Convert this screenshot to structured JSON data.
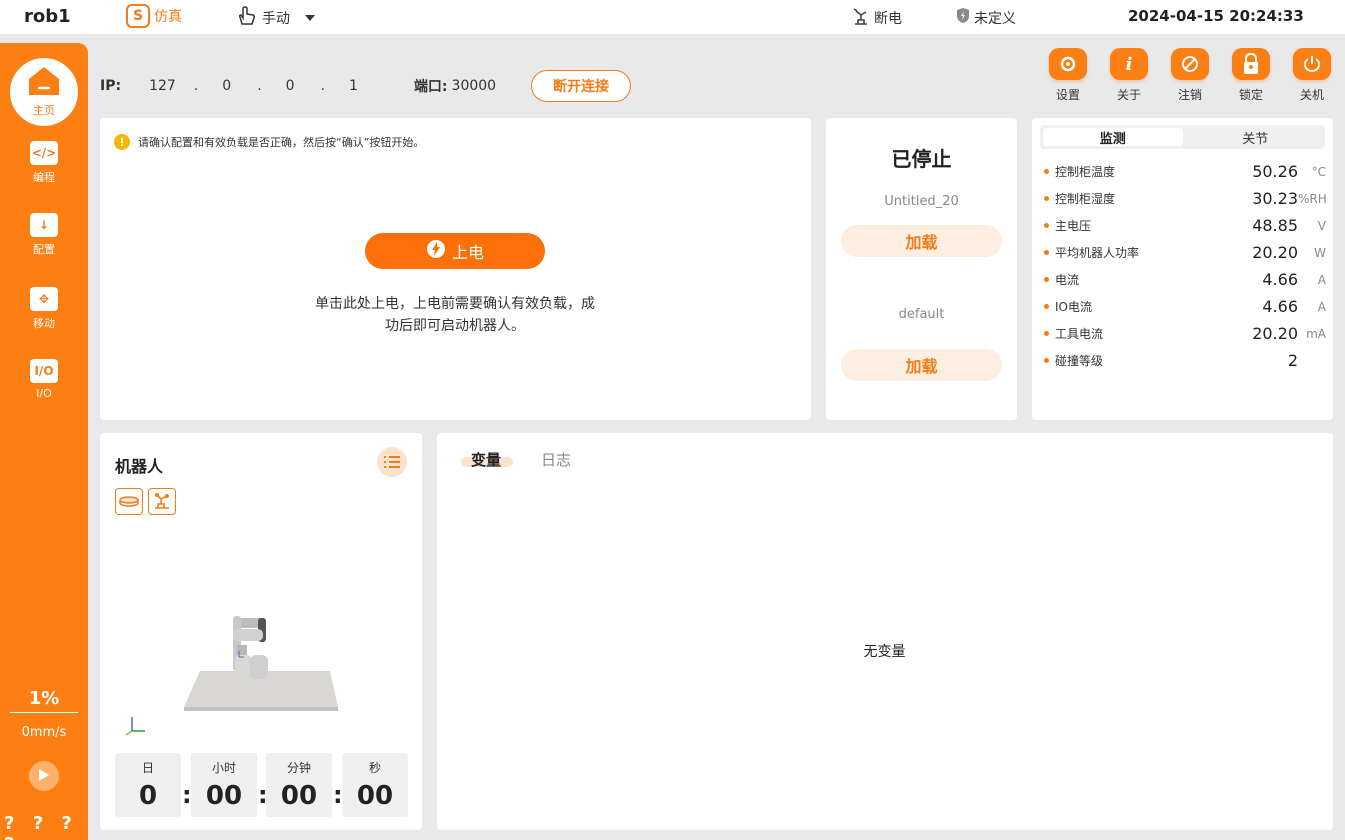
{
  "topbar": {
    "robot_name": "rob1",
    "sim_icon": "S",
    "sim_label": "仿真",
    "manual_label": "手动",
    "power_status": "断电",
    "safety_status": "未定义",
    "datetime": "2024-04-15 20:24:33"
  },
  "sidebar": {
    "home_label": "主页",
    "items": [
      {
        "label": "编程",
        "icon": "</>"
      },
      {
        "label": "配置",
        "icon": "↓"
      },
      {
        "label": "移动",
        "icon": "✥"
      },
      {
        "label": "I/O",
        "icon": "I/O"
      }
    ],
    "speed_percent": "1%",
    "speed_value": "0mm/s",
    "bottom_marks": "? ? ? ?"
  },
  "connection": {
    "ip_label": "IP:",
    "ip": [
      "127",
      "0",
      "0",
      "1"
    ],
    "port_label": "端口:",
    "port": "30000",
    "disconnect_label": "断开连接"
  },
  "actions": [
    {
      "label": "设置",
      "icon": "gear"
    },
    {
      "label": "关于",
      "icon": "info"
    },
    {
      "label": "注销",
      "icon": "logout"
    },
    {
      "label": "锁定",
      "icon": "lock"
    },
    {
      "label": "关机",
      "icon": "power"
    }
  ],
  "main_panel": {
    "notice": "请确认配置和有效负载是否正确，然后按“确认”按钮开始。",
    "power_on_label": "上电",
    "power_desc_1": "单击此处上电，上电前需要确认有效负载，成",
    "power_desc_2": "功后即可启动机器人。"
  },
  "program_panel": {
    "status": "已停止",
    "program_name": "Untitled_20",
    "load_label_1": "加载",
    "payload_name": "default",
    "load_label_2": "加载"
  },
  "monitor": {
    "tab_monitor": "监测",
    "tab_joint": "关节",
    "rows": [
      {
        "label": "控制柜温度",
        "value": "50.26",
        "unit": "°C"
      },
      {
        "label": "控制柜湿度",
        "value": "30.23",
        "unit": "%RH"
      },
      {
        "label": "主电压",
        "value": "48.85",
        "unit": "V"
      },
      {
        "label": "平均机器人功率",
        "value": "20.20",
        "unit": "W"
      },
      {
        "label": "电流",
        "value": "4.66",
        "unit": "A"
      },
      {
        "label": "IO电流",
        "value": "4.66",
        "unit": "A"
      },
      {
        "label": "工具电流",
        "value": "20.20",
        "unit": "mA"
      },
      {
        "label": "碰撞等级",
        "value": "2",
        "unit": ""
      }
    ]
  },
  "robot_panel": {
    "title": "机器人",
    "time": [
      {
        "label": "日",
        "value": "0"
      },
      {
        "label": "小时",
        "value": "00"
      },
      {
        "label": "分钟",
        "value": "00"
      },
      {
        "label": "秒",
        "value": "00"
      }
    ]
  },
  "var_panel": {
    "tab_vars": "变量",
    "tab_log": "日志",
    "empty": "无变量"
  },
  "colors": {
    "accent": "#fb7f12",
    "background": "#e9e9ea",
    "panel": "#ffffff"
  }
}
